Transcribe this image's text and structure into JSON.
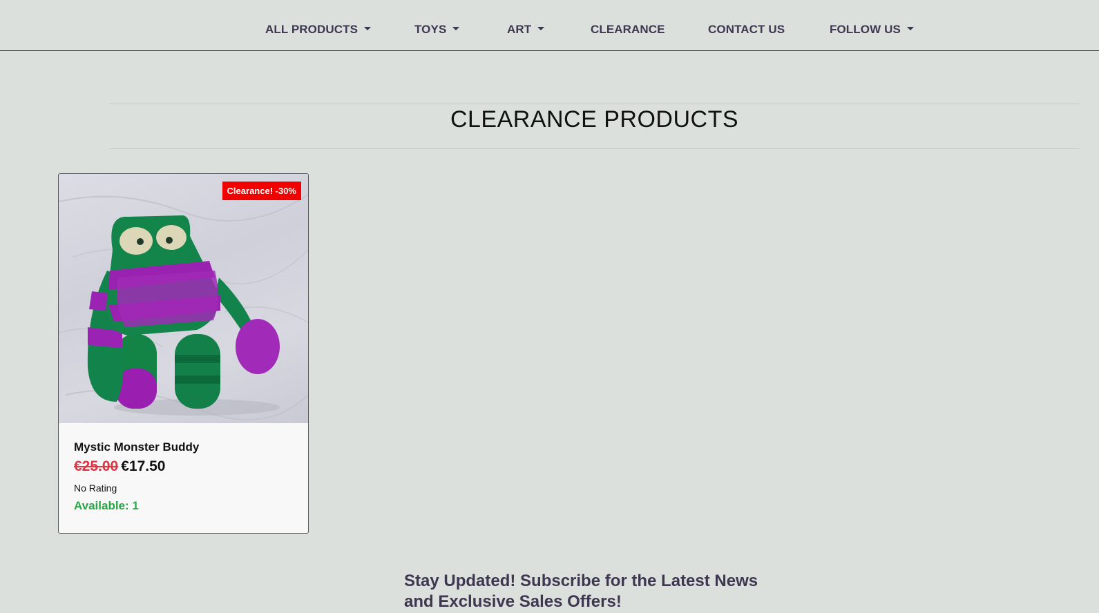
{
  "nav": {
    "items": [
      {
        "label": "ALL PRODUCTS",
        "dropdown": true
      },
      {
        "label": "TOYS",
        "dropdown": true
      },
      {
        "label": "ART",
        "dropdown": true
      },
      {
        "label": "CLEARANCE",
        "dropdown": false
      },
      {
        "label": "CONTACT US",
        "dropdown": false
      },
      {
        "label": "FOLLOW US",
        "dropdown": true
      }
    ]
  },
  "page": {
    "title": "CLEARANCE PRODUCTS"
  },
  "products": [
    {
      "badge": "Clearance! -30%",
      "name": "Mystic Monster Buddy",
      "old_price": "€25.00",
      "new_price": "€17.50",
      "rating": "No Rating",
      "availability": "Available: 1",
      "image_icon": "crochet-monster-toy-image"
    }
  ],
  "subscribe": {
    "heading": "Stay Updated! Subscribe for the Latest News and Exclusive Sales Offers!"
  },
  "colors": {
    "background": "#dbe0dc",
    "nav_text": "#3f3650",
    "badge_bg": "#f20000",
    "old_price": "#dc3545",
    "available": "#28a745"
  }
}
